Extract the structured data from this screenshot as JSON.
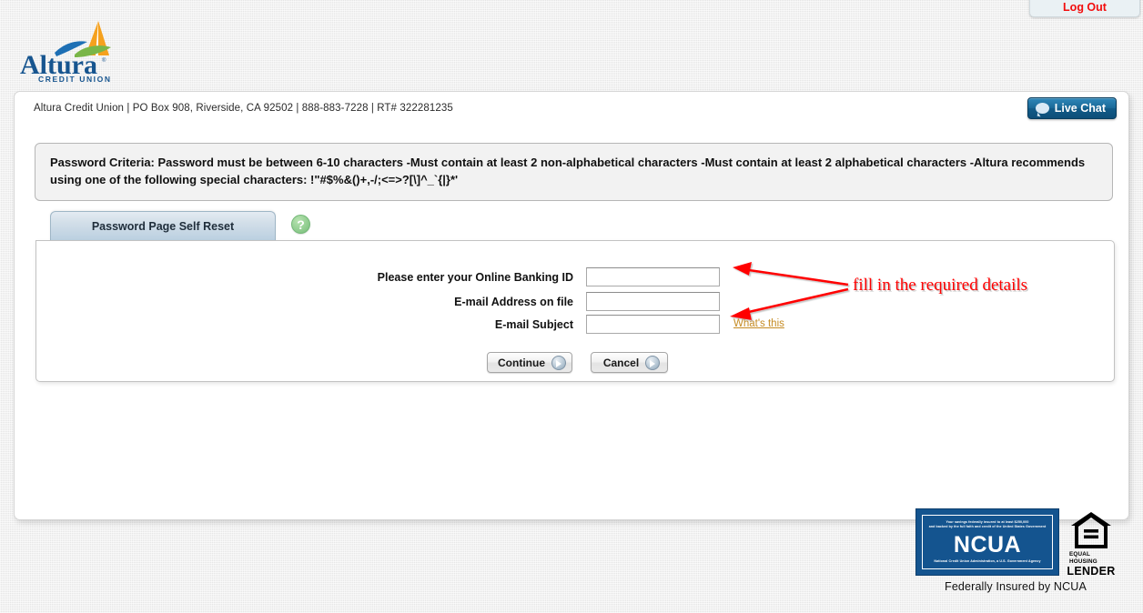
{
  "header": {
    "logout_label": "Log Out",
    "logo_text": "Altura",
    "logo_sub": "CREDIT UNION",
    "contact_line": "Altura Credit Union | PO Box 908, Riverside, CA 92502 | 888-883-7228 | RT# 322281235",
    "live_chat_label": "Live Chat",
    "live_chat_icon": "chat-bubble-icon"
  },
  "criteria": {
    "text": "Password Criteria: Password must be between 6-10 characters -Must contain at least 2 non-alphabetical characters -Must contain at least 2 alphabetical characters -Altura recommends using one of the following special characters: !\"#$%&()+,-/;<=>?[\\]^_`{|}*'"
  },
  "tabs": {
    "active_tab_label": "Password Page Self Reset",
    "help_icon": "question-mark-icon",
    "help_icon_glyph": "?"
  },
  "form": {
    "fields": [
      {
        "label": "Please enter your Online Banking ID",
        "value": "",
        "placeholder": ""
      },
      {
        "label": "E-mail Address on file",
        "value": "",
        "placeholder": ""
      },
      {
        "label": "E-mail Subject",
        "value": "",
        "placeholder": ""
      }
    ],
    "whats_this_label": "What's this",
    "buttons": [
      {
        "label": "Continue",
        "icon": "arrow-right-circle-icon"
      },
      {
        "label": "Cancel",
        "icon": "arrow-right-circle-icon"
      }
    ]
  },
  "annotation": {
    "text": "fill in the required details",
    "color": "#ff0000"
  },
  "footer": {
    "ncua_top_line1": "Your savings federally insured to at least $250,000",
    "ncua_top_line2": "and backed by the full faith and credit of the United States Government",
    "ncua_word": "NCUA",
    "ncua_bottom_line": "National Credit Union Administration, a U.S. Government Agency",
    "ehl_line1": "EQUAL HOUSING",
    "ehl_line2": "LENDER",
    "federally_insured": "Federally Insured by NCUA"
  },
  "colors": {
    "brand_blue": "#1b6a99",
    "ncua_blue": "#14548f",
    "link_gold": "#c58b23",
    "logout_red": "#f20d0d",
    "annotation_red": "#ff0000"
  }
}
